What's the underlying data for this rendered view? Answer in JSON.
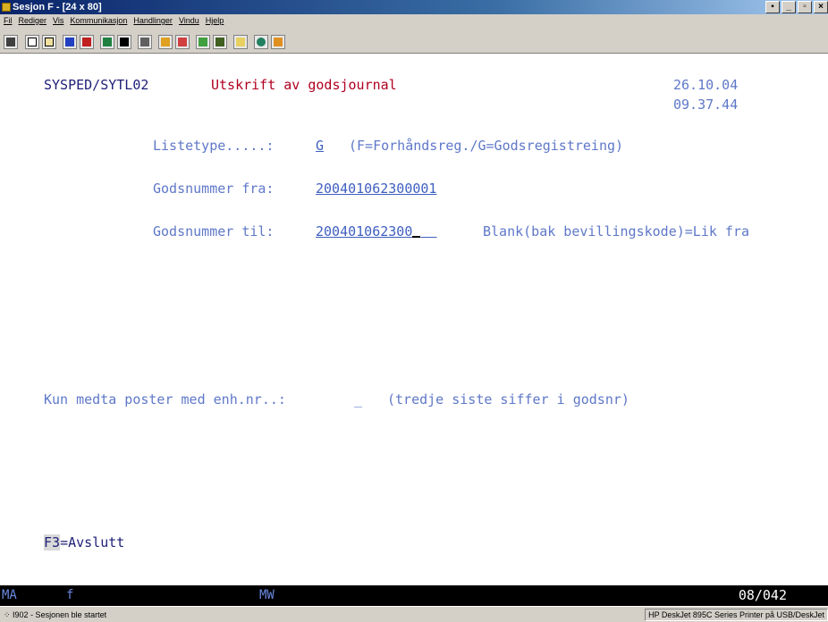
{
  "window": {
    "title": "Sesjon F - [24 x 80]"
  },
  "menu": [
    "Fil",
    "Rediger",
    "Vis",
    "Kommunikasjon",
    "Handlinger",
    "Vindu",
    "Hjelp"
  ],
  "toolbar_icons": [
    "print-screen-icon",
    "copy-icon",
    "paste-icon",
    "send-icon",
    "receive-icon",
    "display-icon",
    "settings-icon",
    "macro-icon",
    "record-icon",
    "play-icon",
    "stop-icon",
    "clipboard-icon",
    "globe-icon",
    "help-icon"
  ],
  "screen": {
    "program_id": "SYSPED/SYTL02",
    "title": "Utskrift av godsjournal",
    "date": "26.10.04",
    "time": "09.37.44",
    "listetype_label": "Listetype.....:",
    "listetype_value": "G",
    "listetype_hint": "(F=Forhåndsreg./G=Godsregistreing)",
    "fra_label": "Godsnummer fra:",
    "fra_value": "200401062300001",
    "til_label": "Godsnummer til:",
    "til_value": "200401062300",
    "til_hint": "Blank(bak bevillingskode)=Lik fra",
    "enh_label": "Kun medta poster med enh.nr..:",
    "enh_value": "_",
    "enh_hint": "(tredje siste siffer i godsnr)",
    "fkey": "F3",
    "fkey_label": "=Avslutt"
  },
  "oia": {
    "mode": "MA",
    "indicator": "f",
    "mw": "MW",
    "cursor_pos": "08/042"
  },
  "statusbar": {
    "message": "I902 - Sesjonen ble startet",
    "printer": "HP DeskJet 895C Series Printer på USB/DeskJet"
  }
}
